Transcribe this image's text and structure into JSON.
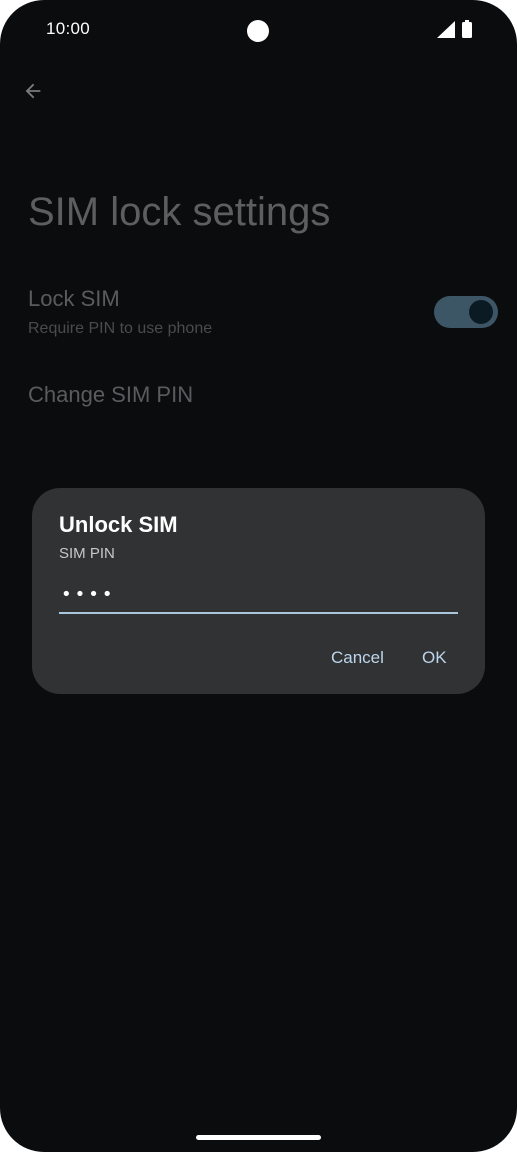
{
  "status_bar": {
    "time": "10:00",
    "icons": [
      "signal-icon",
      "battery-icon"
    ]
  },
  "header": {
    "back_icon": "arrow-left-icon"
  },
  "page": {
    "title": "SIM lock settings"
  },
  "settings": {
    "lock_sim": {
      "title": "Lock SIM",
      "subtitle": "Require PIN to use phone",
      "enabled": true
    },
    "change_pin": {
      "title": "Change SIM PIN"
    }
  },
  "dialog": {
    "title": "Unlock SIM",
    "field_label": "SIM PIN",
    "pin_value": "••••",
    "cancel_label": "Cancel",
    "ok_label": "OK"
  },
  "colors": {
    "background": "#0b0c0e",
    "dialog": "#303234",
    "accent": "#bcd5ea",
    "toggle_track": "#3d5666"
  }
}
